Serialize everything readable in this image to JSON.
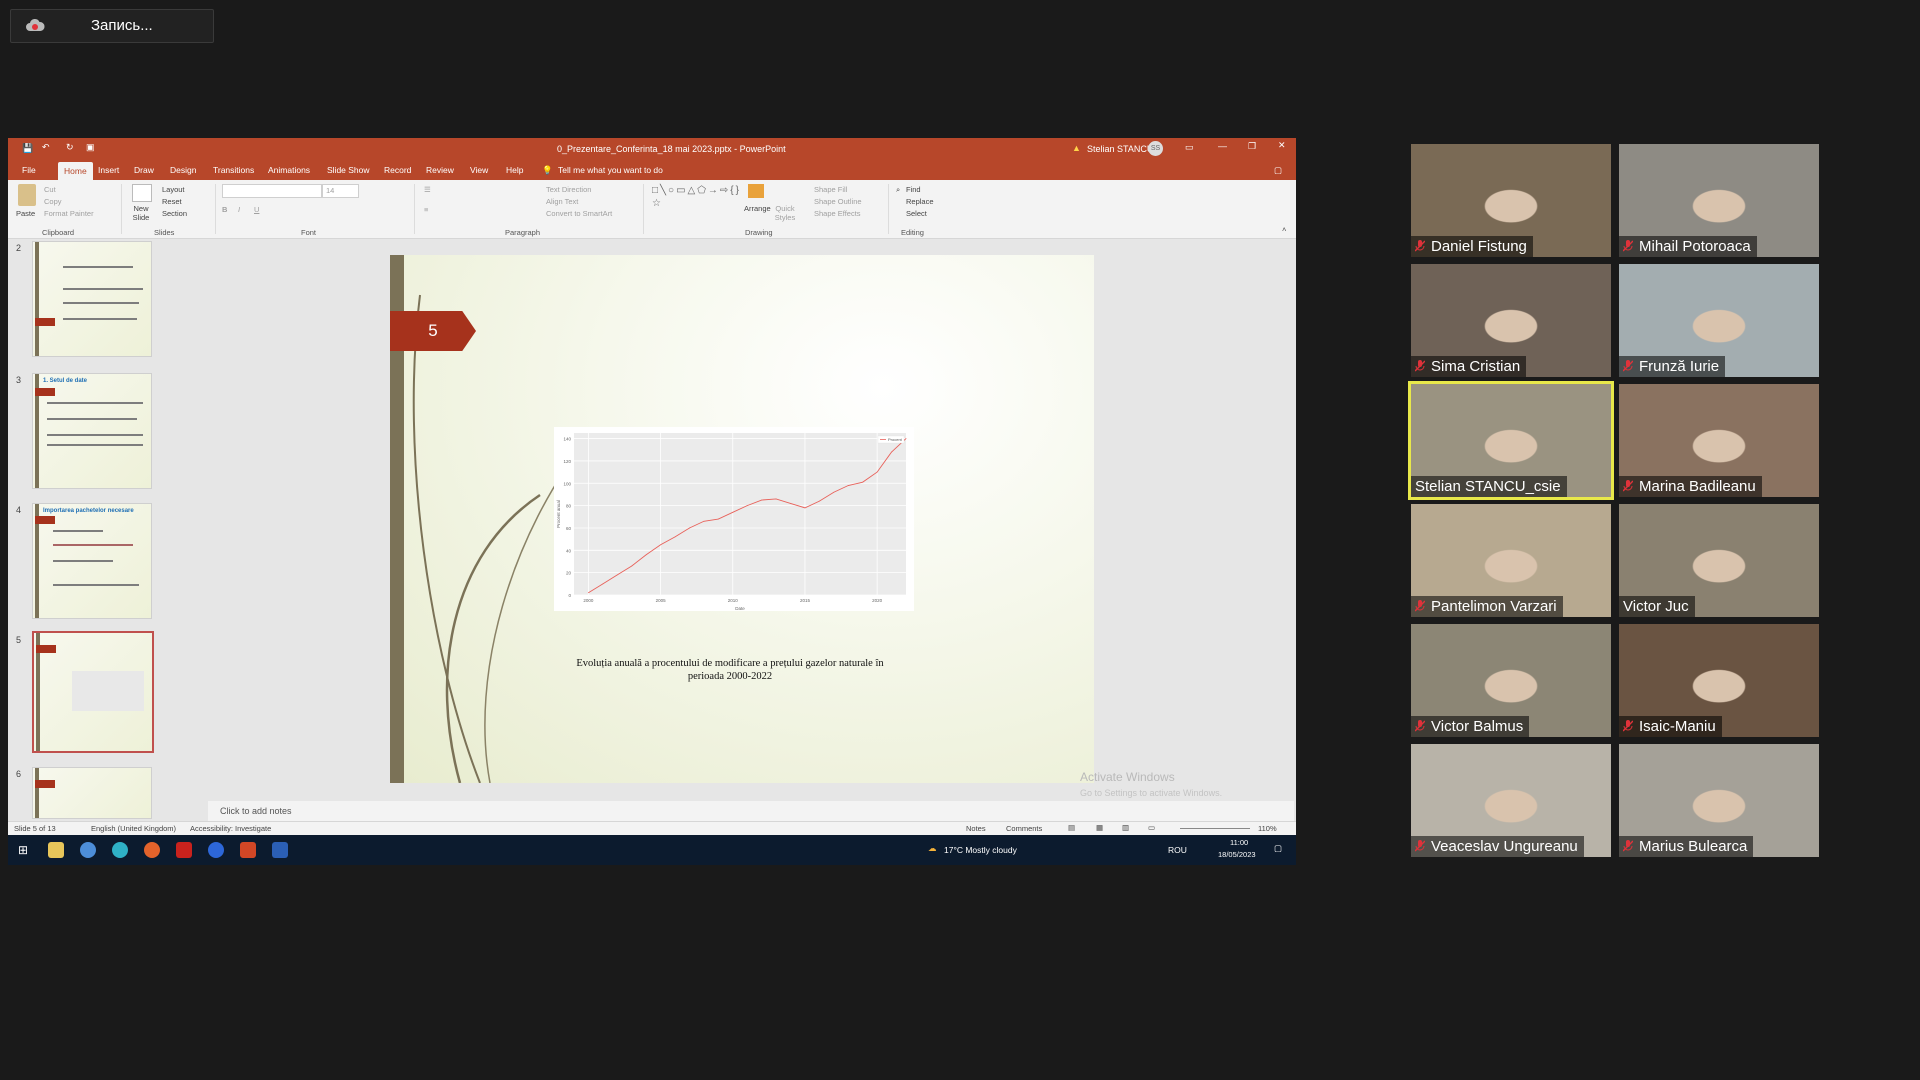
{
  "recording": {
    "label": "Запись..."
  },
  "powerpoint": {
    "window_title": "0_Prezentare_Conferinta_18 mai 2023.pptx  -  PowerPoint",
    "user_name": "Stelian STANCU",
    "user_initials": "SS",
    "tabs": [
      "File",
      "Home",
      "Insert",
      "Draw",
      "Design",
      "Transitions",
      "Animations",
      "Slide Show",
      "Record",
      "Review",
      "View",
      "Help"
    ],
    "tell_me": "Tell me what you want to do",
    "ribbon": {
      "clipboard": {
        "paste": "Paste",
        "cut": "Cut",
        "copy": "Copy",
        "format_painter": "Format Painter",
        "group": "Clipboard"
      },
      "slides": {
        "new_slide": "New Slide",
        "layout": "Layout",
        "reset": "Reset",
        "section": "Section",
        "group": "Slides"
      },
      "font": {
        "size": "14",
        "group": "Font"
      },
      "paragraph": {
        "text_direction": "Text Direction",
        "align_text": "Align Text",
        "convert_smartart": "Convert to SmartArt",
        "group": "Paragraph"
      },
      "drawing": {
        "arrange": "Arrange",
        "quick_styles": "Quick Styles",
        "shape_fill": "Shape Fill",
        "shape_outline": "Shape Outline",
        "shape_effects": "Shape Effects",
        "group": "Drawing"
      },
      "editing": {
        "find": "Find",
        "replace": "Replace",
        "select": "Select",
        "group": "Editing"
      }
    },
    "thumbnails": [
      {
        "num": "2",
        "title": ""
      },
      {
        "num": "3",
        "title": "1. Setul de date"
      },
      {
        "num": "4",
        "title": "Importarea pachetelor necesare"
      },
      {
        "num": "5",
        "title": ""
      },
      {
        "num": "6",
        "title": ""
      }
    ],
    "slide": {
      "number": "5",
      "caption_line1": "Evoluția anuală a procentului de modificare a prețului gazelor naturale în",
      "caption_line2": "perioada 2000-2022"
    },
    "notes_placeholder": "Click to add notes",
    "status": {
      "slide_of": "Slide 5 of 13",
      "language": "English (United Kingdom)",
      "accessibility": "Accessibility: Investigate",
      "notes": "Notes",
      "comments": "Comments",
      "zoom": "110%"
    },
    "watermark": {
      "line1": "Activate Windows",
      "line2": "Go to Settings to activate Windows."
    },
    "taskbar": {
      "weather": "17°C  Mostly cloudy",
      "lang": "ROU",
      "time": "11:00",
      "date": "18/05/2023"
    }
  },
  "chart_data": {
    "type": "line",
    "title": "",
    "xlabel": "Date",
    "ylabel": "Procent anual",
    "legend": "top-right",
    "legend_entries": [
      "Procent"
    ],
    "x_ticks": [
      "2000",
      "2005",
      "2010",
      "2015",
      "2020"
    ],
    "y_ticks": [
      "0",
      "20",
      "40",
      "60",
      "80",
      "100",
      "120",
      "140"
    ],
    "ylim": [
      0,
      145
    ],
    "series": [
      {
        "name": "Procent",
        "color": "#e8615a",
        "x": [
          2000,
          2001,
          2002,
          2003,
          2004,
          2005,
          2006,
          2007,
          2008,
          2009,
          2010,
          2011,
          2012,
          2013,
          2014,
          2015,
          2016,
          2017,
          2018,
          2019,
          2020,
          2021,
          2022
        ],
        "values": [
          2,
          10,
          18,
          26,
          36,
          45,
          52,
          60,
          66,
          68,
          74,
          80,
          85,
          86,
          82,
          78,
          84,
          92,
          98,
          101,
          110,
          128,
          140
        ]
      }
    ]
  },
  "participants": [
    {
      "name": "Daniel Fistung",
      "muted": true,
      "active": false,
      "bg": "#7a6a55"
    },
    {
      "name": "Mihail Potoroaca",
      "muted": true,
      "active": false,
      "bg": "#8e8b84"
    },
    {
      "name": "Sima Cristian",
      "muted": true,
      "active": false,
      "bg": "#6f6257"
    },
    {
      "name": "Frunză Iurie",
      "muted": true,
      "active": false,
      "bg": "#a3adb0"
    },
    {
      "name": "Stelian STANCU_csie",
      "muted": false,
      "active": true,
      "bg": "#9a9381"
    },
    {
      "name": "Marina Badileanu",
      "muted": true,
      "active": false,
      "bg": "#8a7260"
    },
    {
      "name": "Pantelimon Varzari",
      "muted": true,
      "active": false,
      "bg": "#b7a990"
    },
    {
      "name": "Victor Juc",
      "muted": false,
      "active": false,
      "bg": "#8a8170"
    },
    {
      "name": "Victor Balmus",
      "muted": true,
      "active": false,
      "bg": "#8c8675"
    },
    {
      "name": "Isaic-Maniu",
      "muted": true,
      "active": false,
      "bg": "#6a5442"
    },
    {
      "name": "Veaceslav Ungureanu",
      "muted": true,
      "active": false,
      "bg": "#b8b3a8"
    },
    {
      "name": "Marius Bulearca",
      "muted": true,
      "active": false,
      "bg": "#a5a198"
    }
  ]
}
